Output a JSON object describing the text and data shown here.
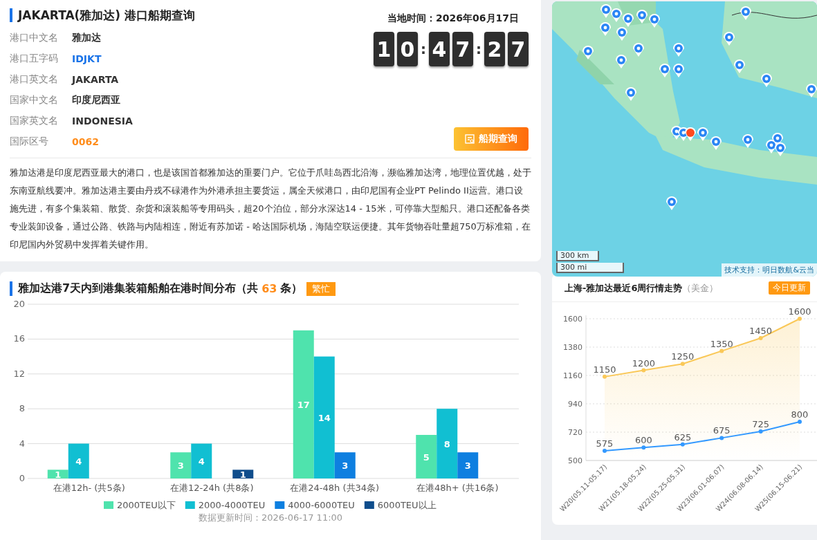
{
  "port": {
    "title": "JAKARTA(雅加达) 港口船期查询",
    "fields": [
      {
        "label": "港口中文名",
        "value": "雅加达",
        "kind": "plain"
      },
      {
        "label": "港口五字码",
        "value": "IDJKT",
        "kind": "code"
      },
      {
        "label": "港口英文名",
        "value": "JAKARTA",
        "kind": "plain"
      },
      {
        "label": "国家中文名",
        "value": "印度尼西亚",
        "kind": "plain"
      },
      {
        "label": "国家英文名",
        "value": "INDONESIA",
        "kind": "plain"
      },
      {
        "label": "国际区号",
        "value": "0062",
        "kind": "number"
      }
    ],
    "local_time": "当地时间：2026年06月17日",
    "clock": {
      "groups": [
        [
          "1",
          "0"
        ],
        [
          "4",
          "7"
        ],
        [
          "2",
          "7"
        ]
      ],
      "separators": [
        ":",
        ":"
      ]
    },
    "button": "船期查询",
    "description": "雅加达港是印度尼西亚最大的港口，也是该国首都雅加达的重要门户。它位于爪哇岛西北沿海，濒临雅加达湾，地理位置优越，处于东南亚航线要冲。雅加达港主要由丹戎不碌港作为外港承担主要货运，属全天候港口，由印尼国有企业PT Pelindo II运营。港口设施先进，有多个集装箱、散货、杂货和滚装船等专用码头，超20个泊位，部分水深达14 - 15米，可停靠大型船只。港口还配备各类专业装卸设备，通过公路、铁路与内陆相连，附近有苏加诺 - 哈达国际机场，海陆空联运便捷。其年货物吞吐量超750万标准箱，在印尼国内外贸易中发挥着关键作用。"
  },
  "map": {
    "kind": "picture",
    "scale": [
      "300 km",
      "300 mi"
    ],
    "attribution": "技术支持：明日数航&云当"
  },
  "distribution": {
    "title": "雅加达港7天内到港集装箱船舶在港时间分布（共",
    "count": "63",
    "title_end": "条）",
    "tag": "繁忙",
    "chart_data": {
      "type": "bar",
      "categories": [
        "在港12h- (共5条)",
        "在港12-24h (共8条)",
        "在港24-48h (共34条)",
        "在港48h+ (共16条)"
      ],
      "series": [
        {
          "name": "2000TEU以下",
          "color": "#4fe3ad",
          "values": [
            1,
            3,
            17,
            5
          ]
        },
        {
          "name": "2000-4000TEU",
          "color": "#11bfd2",
          "values": [
            4,
            4,
            14,
            8
          ]
        },
        {
          "name": "4000-6000TEU",
          "color": "#0e7fe0",
          "values": [
            null,
            null,
            3,
            3
          ]
        },
        {
          "name": "6000TEU以上",
          "color": "#0f4d8c",
          "values": [
            null,
            1,
            null,
            null
          ]
        }
      ],
      "ylim": [
        0,
        20
      ],
      "yticks": [
        0,
        4,
        8,
        12,
        16,
        20
      ],
      "data_labels": true,
      "grid": true,
      "legend": "bottom"
    },
    "updated": "数据更新时间：2026-06-17 11:00"
  },
  "trend": {
    "title": "上海-雅加达最近6周行情走势",
    "unit": "（美金）",
    "tag": "今日更新",
    "chart_data": {
      "type": "area",
      "categories": [
        "W20(05.11-05.17)",
        "W21(05.18-05.24)",
        "W22(05.25-05.31)",
        "W23(06.01-06.07)",
        "W24(06.08-06.14)",
        "W25(06.15-06.21)"
      ],
      "series": [
        {
          "type": "area",
          "color": "#fac858",
          "marker": "circle",
          "values": [
            1150,
            1200,
            1250,
            1350,
            1450,
            1600
          ]
        },
        {
          "type": "line",
          "color": "#3399ff",
          "marker": "circle",
          "values": [
            575,
            600,
            625,
            675,
            725,
            800
          ]
        }
      ],
      "ylim": [
        500,
        1600
      ],
      "yticks": [
        500,
        720,
        940,
        1160,
        1380,
        1600
      ],
      "data_labels": true,
      "grid": true
    }
  }
}
